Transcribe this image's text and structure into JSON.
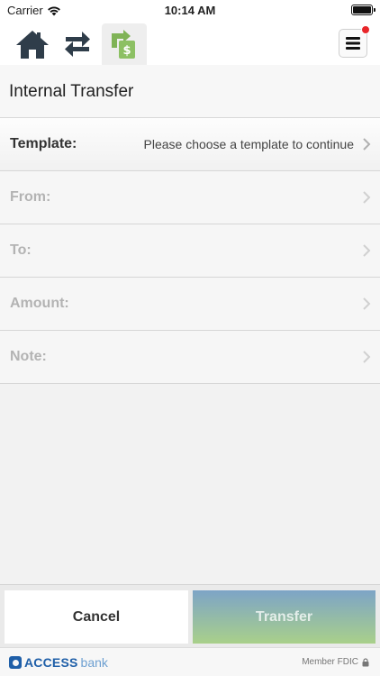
{
  "status_bar": {
    "carrier": "Carrier",
    "time": "10:14 AM",
    "wifi_icon": "wifi-icon",
    "battery_icon": "battery-icon"
  },
  "nav": {
    "home_icon": "home-icon",
    "transfers_icon": "transfers-arrows-icon",
    "internal_transfer_icon": "internal-transfer-icon",
    "menu_icon": "hamburger-menu-icon",
    "badge_color": "#e8262a"
  },
  "page": {
    "title": "Internal Transfer"
  },
  "form": {
    "rows": [
      {
        "label": "Template:",
        "value": "Please choose a template to continue"
      },
      {
        "label": "From:",
        "value": ""
      },
      {
        "label": "To:",
        "value": ""
      },
      {
        "label": "Amount:",
        "value": ""
      },
      {
        "label": "Note:",
        "value": ""
      }
    ]
  },
  "buttons": {
    "cancel_label": "Cancel",
    "transfer_label": "Transfer"
  },
  "footer": {
    "brand_access": "ACCESS",
    "brand_bank": "bank",
    "fdic_label": "Member FDIC",
    "lock_icon": "lock-icon",
    "brand_color": "#1f5fa8"
  }
}
